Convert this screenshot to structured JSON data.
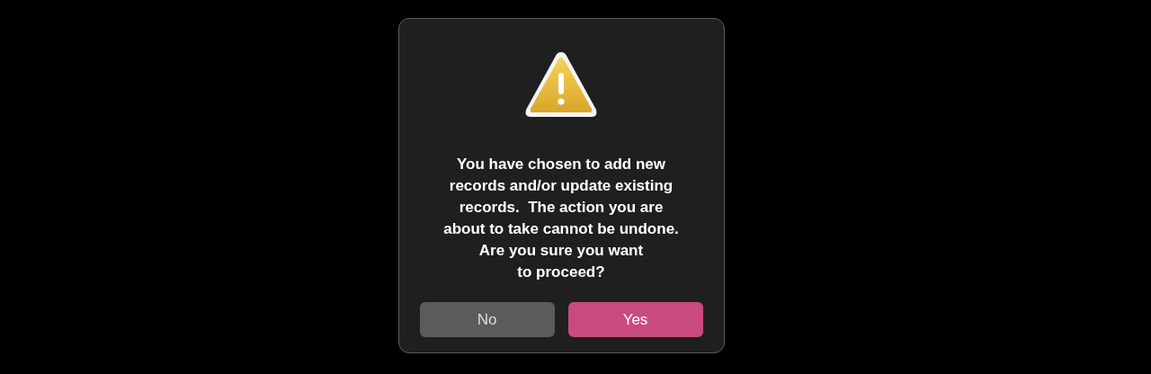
{
  "dialog": {
    "message": "You have chosen to add new\nrecords and/or update existing\nrecords.  The action you are\nabout to take cannot be undone.\nAre you sure you want\nto proceed?",
    "buttons": [
      {
        "label": "No",
        "default": false
      },
      {
        "label": "Yes",
        "default": true
      }
    ]
  }
}
